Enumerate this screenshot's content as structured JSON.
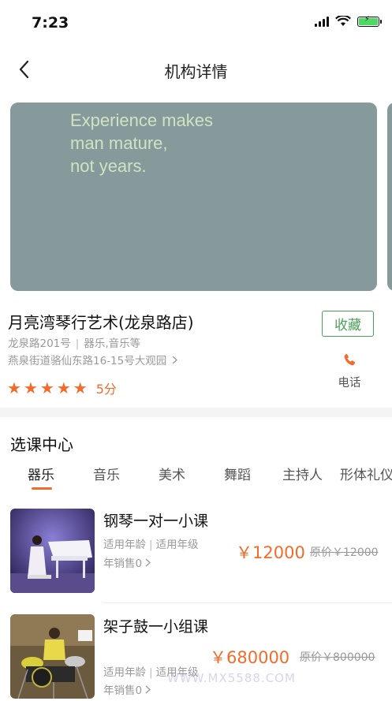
{
  "status_bar": {
    "time": "7:23"
  },
  "nav": {
    "title": "机构详情"
  },
  "banner": {
    "text": "Experience makes\nman mature,\nnot years."
  },
  "org": {
    "name": "月亮湾琴行艺术(龙泉路店)",
    "street": "龙泉路201号",
    "categories": "器乐,音乐等",
    "address": "燕泉街道骆仙东路16-15号大观园",
    "favorite_label": "收藏",
    "phone_label": "电话",
    "score": "5分",
    "stars": 5
  },
  "section": {
    "title": "选课中心"
  },
  "tabs": [
    {
      "label": "器乐",
      "active": true
    },
    {
      "label": "音乐",
      "active": false
    },
    {
      "label": "美术",
      "active": false
    },
    {
      "label": "舞蹈",
      "active": false
    },
    {
      "label": "主持人",
      "active": false
    },
    {
      "label": "形体礼仪",
      "active": false
    }
  ],
  "courses": [
    {
      "name": "钢琴一对一小课",
      "age": "适用年龄",
      "grade": "适用年级",
      "sold": "年销售0",
      "price": "￥12000",
      "original": "原价￥12000"
    },
    {
      "name": "架子鼓一小组课",
      "age": "适用年龄",
      "grade": "适用年级",
      "sold": "年销售0",
      "price": "￥680000",
      "original": "原价￥800000"
    }
  ],
  "watermark": "WWW.MX5588.COM",
  "colors": {
    "accent": "#f26b2a",
    "favorite": "#4aa05a",
    "banner": "#879a9b"
  }
}
